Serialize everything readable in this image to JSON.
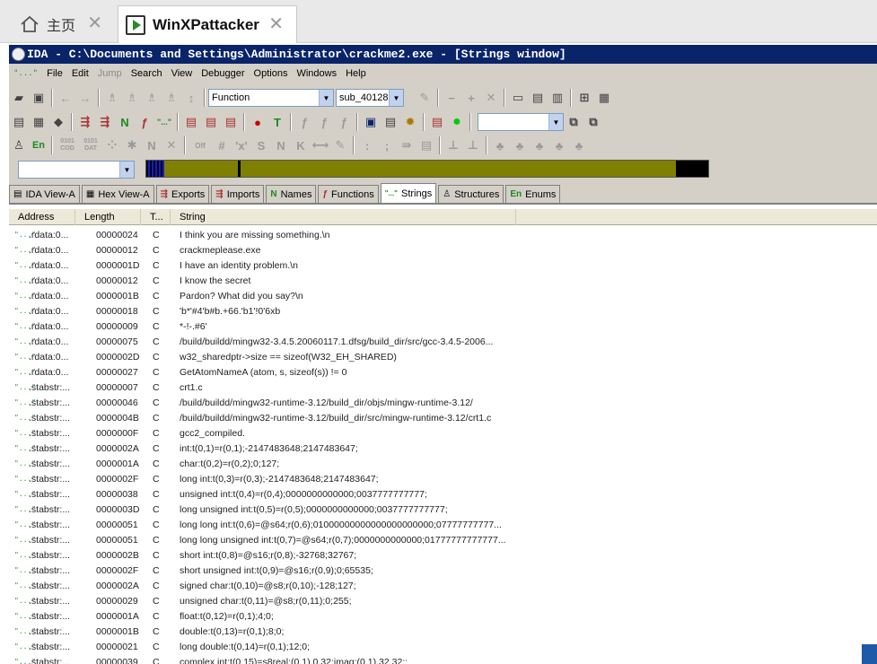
{
  "browser": {
    "tabs": [
      {
        "label": "主页",
        "icon": "home-icon"
      },
      {
        "label": "WinXPattacker",
        "icon": "vm-icon"
      }
    ],
    "close_glyph": "✕"
  },
  "window": {
    "title": "IDA - C:\\Documents and Settings\\Administrator\\crackme2.exe - [Strings window]"
  },
  "menu": {
    "items": [
      "File",
      "Edit",
      "Jump",
      "Search",
      "View",
      "Debugger",
      "Options",
      "Windows",
      "Help"
    ],
    "disabled": [
      "Jump"
    ]
  },
  "toolbar": {
    "function_combo": "Function",
    "sub_combo": "sub_40128",
    "n_label": "N",
    "t_label": "T",
    "en_label": "En",
    "cod_label": "0101 COD",
    "dat_label": "0101 DAT",
    "off_label": "Off"
  },
  "view_tabs": [
    {
      "label": "IDA View-A"
    },
    {
      "label": "Hex View-A"
    },
    {
      "label": "Exports"
    },
    {
      "label": "Imports"
    },
    {
      "label": "Names"
    },
    {
      "label": "Functions"
    },
    {
      "label": "Strings",
      "active": true
    },
    {
      "label": "Structures"
    },
    {
      "label": "Enums"
    }
  ],
  "strings_table": {
    "columns": [
      "Address",
      "Length",
      "T...",
      "String"
    ],
    "row_icon": "\"...\"",
    "rows": [
      [
        ".rdata:0...",
        "00000024",
        "C",
        "I think you are missing something.\\n"
      ],
      [
        ".rdata:0...",
        "00000012",
        "C",
        "crackmeplease.exe"
      ],
      [
        ".rdata:0...",
        "0000001D",
        "C",
        "I have an identity problem.\\n"
      ],
      [
        ".rdata:0...",
        "00000012",
        "C",
        "I know the secret"
      ],
      [
        ".rdata:0...",
        "0000001B",
        "C",
        "Pardon? What did you say?\\n"
      ],
      [
        ".rdata:0...",
        "00000018",
        "C",
        "'b*'#4'b#b.+66.'b1'!0'6xb"
      ],
      [
        ".rdata:0...",
        "00000009",
        "C",
        "*-!-.#6'"
      ],
      [
        ".rdata:0...",
        "00000075",
        "C",
        "/build/buildd/mingw32-3.4.5.20060117.1.dfsg/build_dir/src/gcc-3.4.5-2006..."
      ],
      [
        ".rdata:0...",
        "0000002D",
        "C",
        "w32_sharedptr->size == sizeof(W32_EH_SHARED)"
      ],
      [
        ".rdata:0...",
        "00000027",
        "C",
        "GetAtomNameA (atom, s, sizeof(s)) != 0"
      ],
      [
        ".stabstr:...",
        "00000007",
        "C",
        "crt1.c"
      ],
      [
        ".stabstr:...",
        "00000046",
        "C",
        "/build/buildd/mingw32-runtime-3.12/build_dir/objs/mingw-runtime-3.12/"
      ],
      [
        ".stabstr:...",
        "0000004B",
        "C",
        "/build/buildd/mingw32-runtime-3.12/build_dir/src/mingw-runtime-3.12/crt1.c"
      ],
      [
        ".stabstr:...",
        "0000000F",
        "C",
        "gcc2_compiled."
      ],
      [
        ".stabstr:...",
        "0000002A",
        "C",
        "int:t(0,1)=r(0,1);-2147483648;2147483647;"
      ],
      [
        ".stabstr:...",
        "0000001A",
        "C",
        "char:t(0,2)=r(0,2);0;127;"
      ],
      [
        ".stabstr:...",
        "0000002F",
        "C",
        "long int:t(0,3)=r(0,3);-2147483648;2147483647;"
      ],
      [
        ".stabstr:...",
        "00000038",
        "C",
        "unsigned int:t(0,4)=r(0,4);0000000000000;0037777777777;"
      ],
      [
        ".stabstr:...",
        "0000003D",
        "C",
        "long unsigned int:t(0,5)=r(0,5);0000000000000;0037777777777;"
      ],
      [
        ".stabstr:...",
        "00000051",
        "C",
        "long long int:t(0,6)=@s64;r(0,6);01000000000000000000000;07777777777..."
      ],
      [
        ".stabstr:...",
        "00000051",
        "C",
        "long long unsigned int:t(0,7)=@s64;r(0,7);0000000000000;01777777777777..."
      ],
      [
        ".stabstr:...",
        "0000002B",
        "C",
        "short int:t(0,8)=@s16;r(0,8);-32768;32767;"
      ],
      [
        ".stabstr:...",
        "0000002F",
        "C",
        "short unsigned int:t(0,9)=@s16;r(0,9);0;65535;"
      ],
      [
        ".stabstr:...",
        "0000002A",
        "C",
        "signed char:t(0,10)=@s8;r(0,10);-128;127;"
      ],
      [
        ".stabstr:...",
        "00000029",
        "C",
        "unsigned char:t(0,11)=@s8;r(0,11);0;255;"
      ],
      [
        ".stabstr:...",
        "0000001A",
        "C",
        "float:t(0,12)=r(0,1);4;0;"
      ],
      [
        ".stabstr:...",
        "0000001B",
        "C",
        "double:t(0,13)=r(0,1);8;0;"
      ],
      [
        ".stabstr:...",
        "00000021",
        "C",
        "long double:t(0,14)=r(0,1);12;0;"
      ],
      [
        ".stabstr:...",
        "00000039",
        "C",
        "complex int:t(0,15)=s8real:(0,1),0,32;imag:(0,1),32,32;;"
      ]
    ]
  },
  "colors": {
    "titlebar": "#0a246a",
    "nav_band": "#808000",
    "chrome": "#d4d0c8"
  }
}
